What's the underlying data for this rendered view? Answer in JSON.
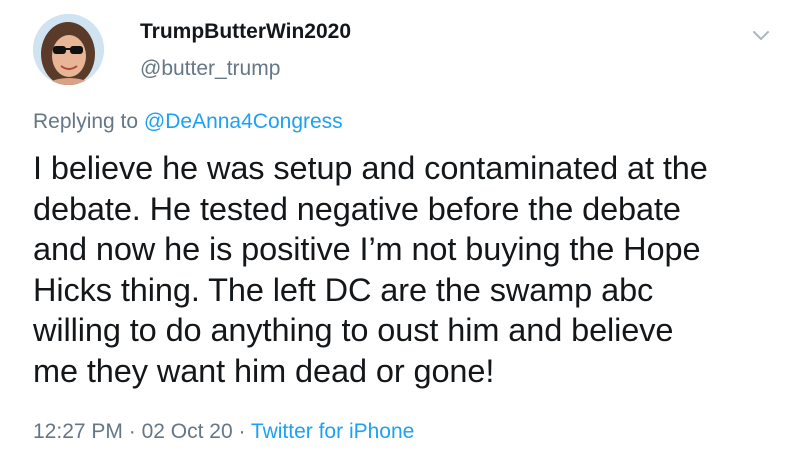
{
  "author": {
    "display_name": "TrumpButterWin2020",
    "handle": "@butter_trump"
  },
  "reply": {
    "prefix": "Replying to ",
    "mention": "@DeAnna4Congress"
  },
  "tweet": {
    "text": "I believe he was setup and contaminated at the\ndebate. He tested negative before the debate\nand now he is positive I’m not buying the Hope\nHicks thing. The left DC are the swamp abc\nwilling to do anything to oust him and believe\nme they want him dead or gone!"
  },
  "meta": {
    "time": "12:27 PM",
    "separator": " · ",
    "date": "02 Oct 20",
    "source": "Twitter for iPhone"
  },
  "icons": {
    "menu": "chevron-down-icon",
    "avatar": "avatar"
  },
  "colors": {
    "text": "#14171a",
    "secondary": "#657786",
    "link": "#1da1f2",
    "background": "#ffffff"
  }
}
